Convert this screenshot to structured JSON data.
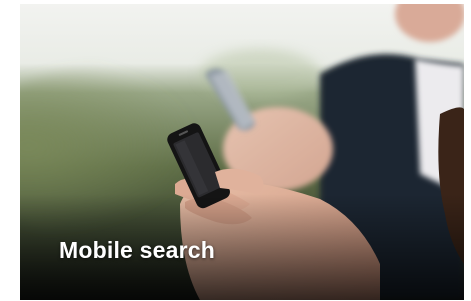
{
  "photo": {
    "caption": "Mobile search",
    "subject": "hands-holding-smartphones-photo"
  }
}
